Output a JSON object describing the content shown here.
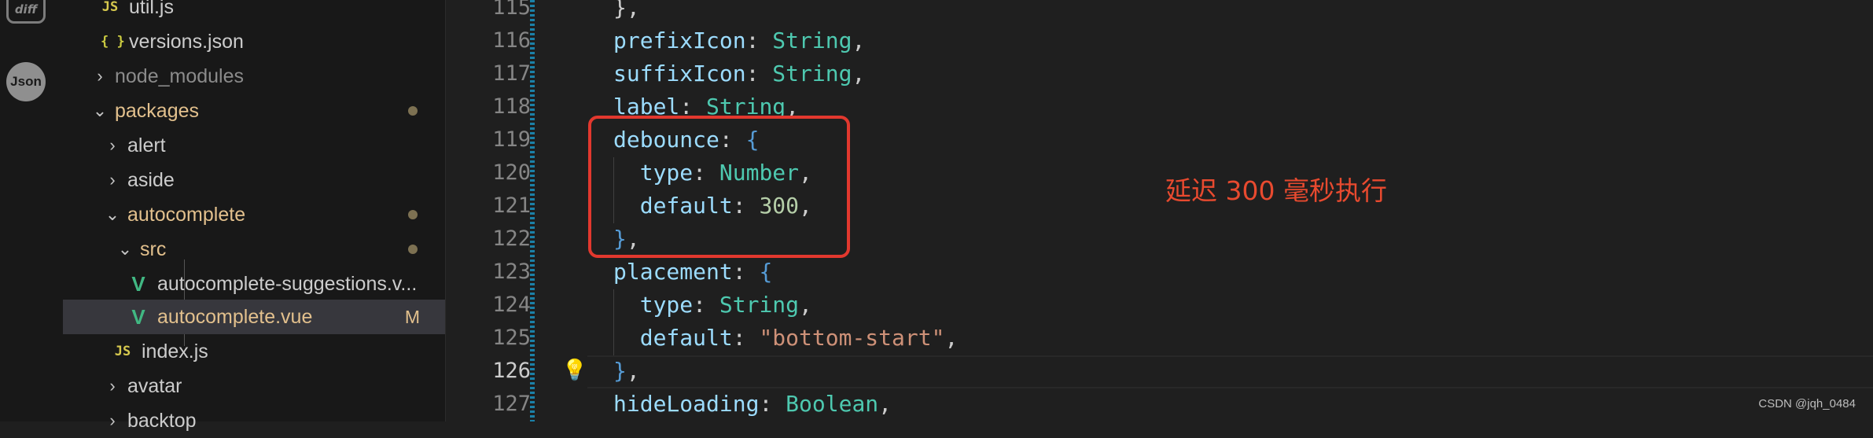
{
  "explorer": {
    "items": [
      {
        "label": "util.js",
        "icon": "js-icon",
        "icon_text": "JS"
      },
      {
        "label": "versions.json",
        "icon": "json-icon",
        "icon_text": "{ }"
      },
      {
        "label": "node_modules",
        "chevron": "›"
      },
      {
        "label": "packages",
        "chevron": "⌄"
      },
      {
        "label": "alert",
        "chevron": "›"
      },
      {
        "label": "aside",
        "chevron": "›"
      },
      {
        "label": "autocomplete",
        "chevron": "⌄"
      },
      {
        "label": "src",
        "chevron": "⌄"
      },
      {
        "label": "autocomplete-suggestions.v...",
        "icon": "vue-icon",
        "icon_text": "V"
      },
      {
        "label": "autocomplete.vue",
        "icon": "vue-icon",
        "icon_text": "V",
        "badge": "M"
      },
      {
        "label": "index.js",
        "icon": "js-icon",
        "icon_text": "JS"
      },
      {
        "label": "avatar",
        "chevron": "›"
      },
      {
        "label": "backtop",
        "chevron": "›"
      }
    ]
  },
  "activity": {
    "diff_icon_text": "diff",
    "json_icon_text": "Json"
  },
  "editor": {
    "lines": [
      {
        "num": "115",
        "tokens": [
          {
            "t": "},",
            "c": "punc"
          }
        ]
      },
      {
        "num": "116",
        "tokens": [
          {
            "t": "prefixIcon",
            "c": "prop"
          },
          {
            "t": ": ",
            "c": "punc"
          },
          {
            "t": "String",
            "c": "type"
          },
          {
            "t": ",",
            "c": "punc"
          }
        ]
      },
      {
        "num": "117",
        "tokens": [
          {
            "t": "suffixIcon",
            "c": "prop"
          },
          {
            "t": ": ",
            "c": "punc"
          },
          {
            "t": "String",
            "c": "type"
          },
          {
            "t": ",",
            "c": "punc"
          }
        ]
      },
      {
        "num": "118",
        "tokens": [
          {
            "t": "label",
            "c": "prop"
          },
          {
            "t": ": ",
            "c": "punc"
          },
          {
            "t": "String",
            "c": "type"
          },
          {
            "t": ",",
            "c": "punc"
          }
        ]
      },
      {
        "num": "119",
        "tokens": [
          {
            "t": "debounce",
            "c": "prop"
          },
          {
            "t": ": ",
            "c": "punc"
          },
          {
            "t": "{",
            "c": "brace"
          }
        ]
      },
      {
        "num": "120",
        "tokens": [
          {
            "t": "  type",
            "c": "prop"
          },
          {
            "t": ": ",
            "c": "punc"
          },
          {
            "t": "Number",
            "c": "type"
          },
          {
            "t": ",",
            "c": "punc"
          }
        ]
      },
      {
        "num": "121",
        "tokens": [
          {
            "t": "  default",
            "c": "prop"
          },
          {
            "t": ": ",
            "c": "punc"
          },
          {
            "t": "300",
            "c": "num"
          },
          {
            "t": ",",
            "c": "punc"
          }
        ]
      },
      {
        "num": "122",
        "tokens": [
          {
            "t": "}",
            "c": "brace"
          },
          {
            "t": ",",
            "c": "punc"
          }
        ]
      },
      {
        "num": "123",
        "tokens": [
          {
            "t": "placement",
            "c": "prop"
          },
          {
            "t": ": ",
            "c": "punc"
          },
          {
            "t": "{",
            "c": "brace"
          }
        ]
      },
      {
        "num": "124",
        "tokens": [
          {
            "t": "  type",
            "c": "prop"
          },
          {
            "t": ": ",
            "c": "punc"
          },
          {
            "t": "String",
            "c": "type"
          },
          {
            "t": ",",
            "c": "punc"
          }
        ]
      },
      {
        "num": "125",
        "tokens": [
          {
            "t": "  default",
            "c": "prop"
          },
          {
            "t": ": ",
            "c": "punc"
          },
          {
            "t": "\"bottom-start\"",
            "c": "str"
          },
          {
            "t": ",",
            "c": "punc"
          }
        ]
      },
      {
        "num": "126",
        "tokens": [
          {
            "t": "}",
            "c": "brace"
          },
          {
            "t": ",",
            "c": "punc"
          }
        ]
      },
      {
        "num": "127",
        "tokens": [
          {
            "t": "hideLoading",
            "c": "prop"
          },
          {
            "t": ": ",
            "c": "punc"
          },
          {
            "t": "Boolean",
            "c": "type"
          },
          {
            "t": ",",
            "c": "punc"
          }
        ]
      }
    ],
    "active_line": "126"
  },
  "annotation": {
    "text": "延迟 300 毫秒执行"
  },
  "watermark": "CSDN @jqh_0484",
  "colors": {
    "highlight_box": "#e2382e",
    "annotation": "#e84a2f",
    "modified": "#e2c08d"
  }
}
